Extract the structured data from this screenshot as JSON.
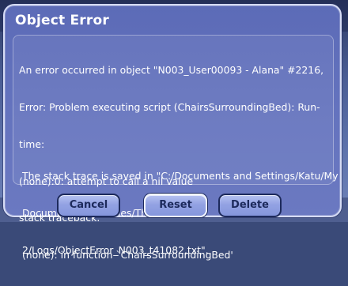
{
  "dialog": {
    "title": "Object Error",
    "message_lines": [
      "An error occurred in object \"N003_User00093 - Alana\" #2216,",
      "Error: Problem executing script (ChairsSurroundingBed): Run-",
      "time:",
      "(none):0: attempt to call a nil value",
      "stack traceback:",
      " (none): in function `ChairsSurroundingBed'"
    ],
    "trace_lines": [
      "The stack trace is saved in \"C:/Documents and Settings/Katu/My",
      "Documents/EA Games/The Sims",
      "2/Logs/ObjectError_N003_t41082.txt\"."
    ]
  },
  "buttons": {
    "cancel": "Cancel",
    "reset": "Reset",
    "delete": "Delete"
  },
  "colors": {
    "dialog_bg": "#6473be",
    "button_text": "#1d2a5c",
    "button_bg": "#93a2e3"
  }
}
